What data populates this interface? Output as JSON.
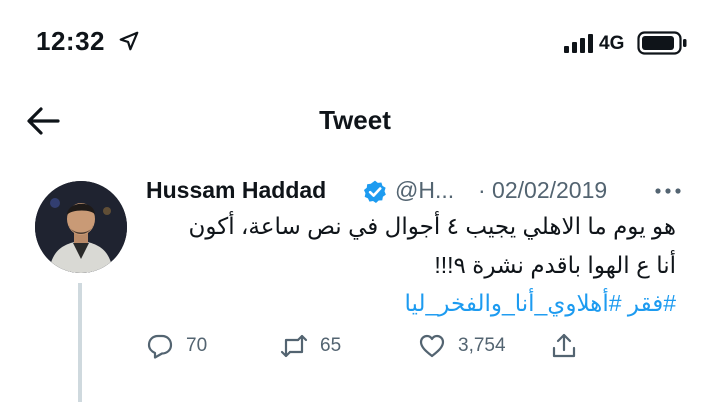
{
  "status_bar": {
    "time": "12:32",
    "network": "4G",
    "icons": [
      "location-arrow-icon",
      "signal-bars-icon",
      "battery-icon"
    ]
  },
  "header": {
    "title": "Tweet",
    "back_icon": "arrow-left-icon"
  },
  "tweet": {
    "author_name": "Hussam Haddad",
    "verified": true,
    "handle": "@H...",
    "separator_date": "· 02/02/2019",
    "text_line_1": "هو يوم ما الاهلي يجيب ٤ أجوال في نص ساعة، أكون",
    "text_line_2": "أنا ع الهوا باقدم نشرة ٩!!!",
    "hashtags": "#فقر #أهلاوي_أنا_والفخر_ليا",
    "more_icon": "more-horizontal-icon"
  },
  "actions": {
    "reply_count": "70",
    "retweet_count": "65",
    "like_count": "3,754"
  },
  "colors": {
    "link": "#1d9bf0",
    "secondary_text": "#536471",
    "verified": "#1d9bf0",
    "thread_line": "#cfd9de"
  }
}
